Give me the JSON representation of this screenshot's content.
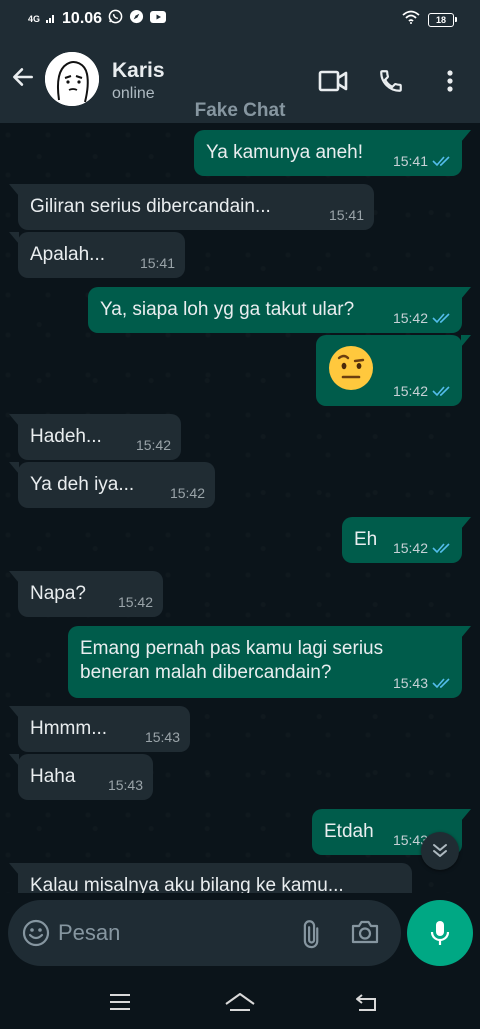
{
  "status_bar": {
    "network": "4G",
    "time": "10.06",
    "battery": "18"
  },
  "header": {
    "contact_name": "Karis",
    "contact_status": "online",
    "watermark": "Fake Chat"
  },
  "messages": [
    {
      "dir": "out",
      "text": "Ya kamunya aneh!",
      "time": "15:41",
      "read": true
    },
    {
      "dir": "in",
      "text": "Giliran serius dibercandain...",
      "time": "15:41"
    },
    {
      "dir": "in",
      "text": "Apalah...",
      "time": "15:41"
    },
    {
      "dir": "out",
      "text": "Ya, siapa loh yg ga takut ular?",
      "time": "15:42",
      "read": true
    },
    {
      "dir": "out",
      "emoji": "raised-eyebrow-face",
      "time": "15:42",
      "read": true
    },
    {
      "dir": "in",
      "text": "Hadeh...",
      "time": "15:42"
    },
    {
      "dir": "in",
      "text": "Ya deh iya...",
      "time": "15:42"
    },
    {
      "dir": "out",
      "text": "Eh",
      "time": "15:42",
      "read": true
    },
    {
      "dir": "in",
      "text": "Napa?",
      "time": "15:42"
    },
    {
      "dir": "out",
      "text_line1": "Emang pernah pas kamu lagi serius",
      "text_line2": "beneran malah dibercandain?",
      "time": "15:43",
      "read": true
    },
    {
      "dir": "in",
      "text": "Hmmm...",
      "time": "15:43"
    },
    {
      "dir": "in",
      "text": "Haha",
      "time": "15:43"
    },
    {
      "dir": "out",
      "text": "Etdah",
      "time": "15:43",
      "read": true
    },
    {
      "dir": "in",
      "text": "Kalau misalnya aku bilang ke kamu..."
    }
  ],
  "composer": {
    "placeholder": "Pesan"
  },
  "colors": {
    "outgoing": "#005c4b",
    "incoming": "#202c33",
    "accent": "#00a884",
    "tick": "#53bdeb"
  },
  "icons": [
    "back-arrow-icon",
    "video-call-icon",
    "phone-icon",
    "more-menu-icon",
    "emoji-icon",
    "attach-icon",
    "camera-icon",
    "mic-icon",
    "chevron-double-down-icon"
  ]
}
